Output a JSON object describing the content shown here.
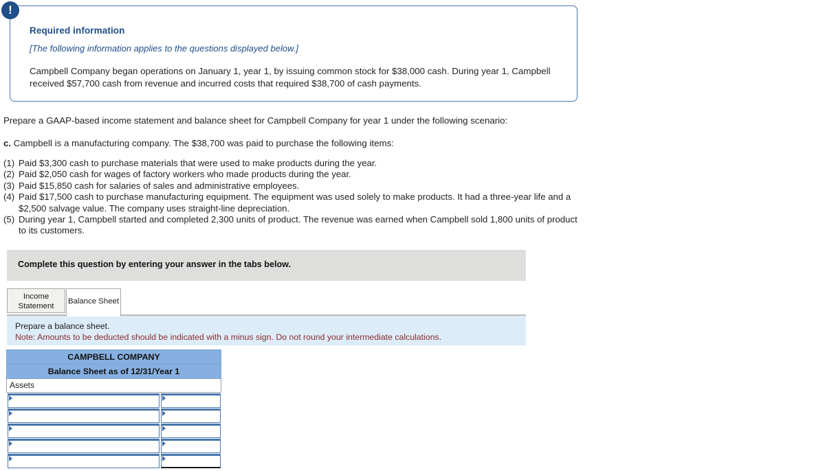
{
  "callout": {
    "icon": "exclamation-circle-icon",
    "badge_glyph": "!",
    "heading": "Required information",
    "italic_note": "[The following information applies to the questions displayed below.]",
    "body": "Campbell Company began operations on January 1, year 1, by issuing common stock for $38,000 cash. During year 1, Campbell received $57,700 cash from revenue and incurred costs that required $38,700 of cash payments.",
    "border_color": "#4a76ad",
    "heading_color": "#1f4e89",
    "badge_color": "#1f4e89"
  },
  "prompt": {
    "intro": "Prepare a GAAP-based income statement and balance sheet for Campbell Company for year 1 under the following scenario:",
    "part_label": "c.",
    "part_text": "Campbell is a manufacturing company. The $38,700 was paid to purchase the following items:",
    "items": [
      {
        "num": "(1)",
        "text": "Paid $3,300 cash to purchase materials that were used to make products during the year."
      },
      {
        "num": "(2)",
        "text": "Paid $2,050 cash for wages of factory workers who made products during the year."
      },
      {
        "num": "(3)",
        "text": "Paid $15,850 cash for salaries of sales and administrative employees."
      },
      {
        "num": "(4)",
        "text": "Paid $17,500 cash to purchase manufacturing equipment. The equipment was used solely to make products. It had a three-year life and a $2,500 salvage value. The company uses straight-line depreciation."
      },
      {
        "num": "(5)",
        "text": "During year 1, Campbell started and completed 2,300 units of product. The revenue was earned when Campbell sold 1,800 units of product to its customers."
      }
    ]
  },
  "instruction_bar": {
    "text": "Complete this question by entering your answer in the tabs below.",
    "background": "#dededc"
  },
  "tabs": [
    {
      "label": "Income Statement",
      "active": false
    },
    {
      "label": "Balance Sheet",
      "active": true
    }
  ],
  "note_band": {
    "line1": "Prepare a balance sheet.",
    "line2": "Note: Amounts to be deducted should be indicated with a minus sign. Do not round your intermediate calculations.",
    "background": "#ddecf9",
    "note_color": "#8b2c2c"
  },
  "balance_sheet": {
    "header_background": "#86b0e1",
    "title_line1": "CAMPBELL COMPANY",
    "title_line2": "Balance Sheet as of 12/31/Year 1",
    "section_label": "Assets",
    "rows": [
      {
        "label": "",
        "amount": ""
      },
      {
        "label": "",
        "amount": ""
      },
      {
        "label": "",
        "amount": ""
      },
      {
        "label": "",
        "amount": ""
      },
      {
        "label": "",
        "amount": ""
      }
    ]
  }
}
